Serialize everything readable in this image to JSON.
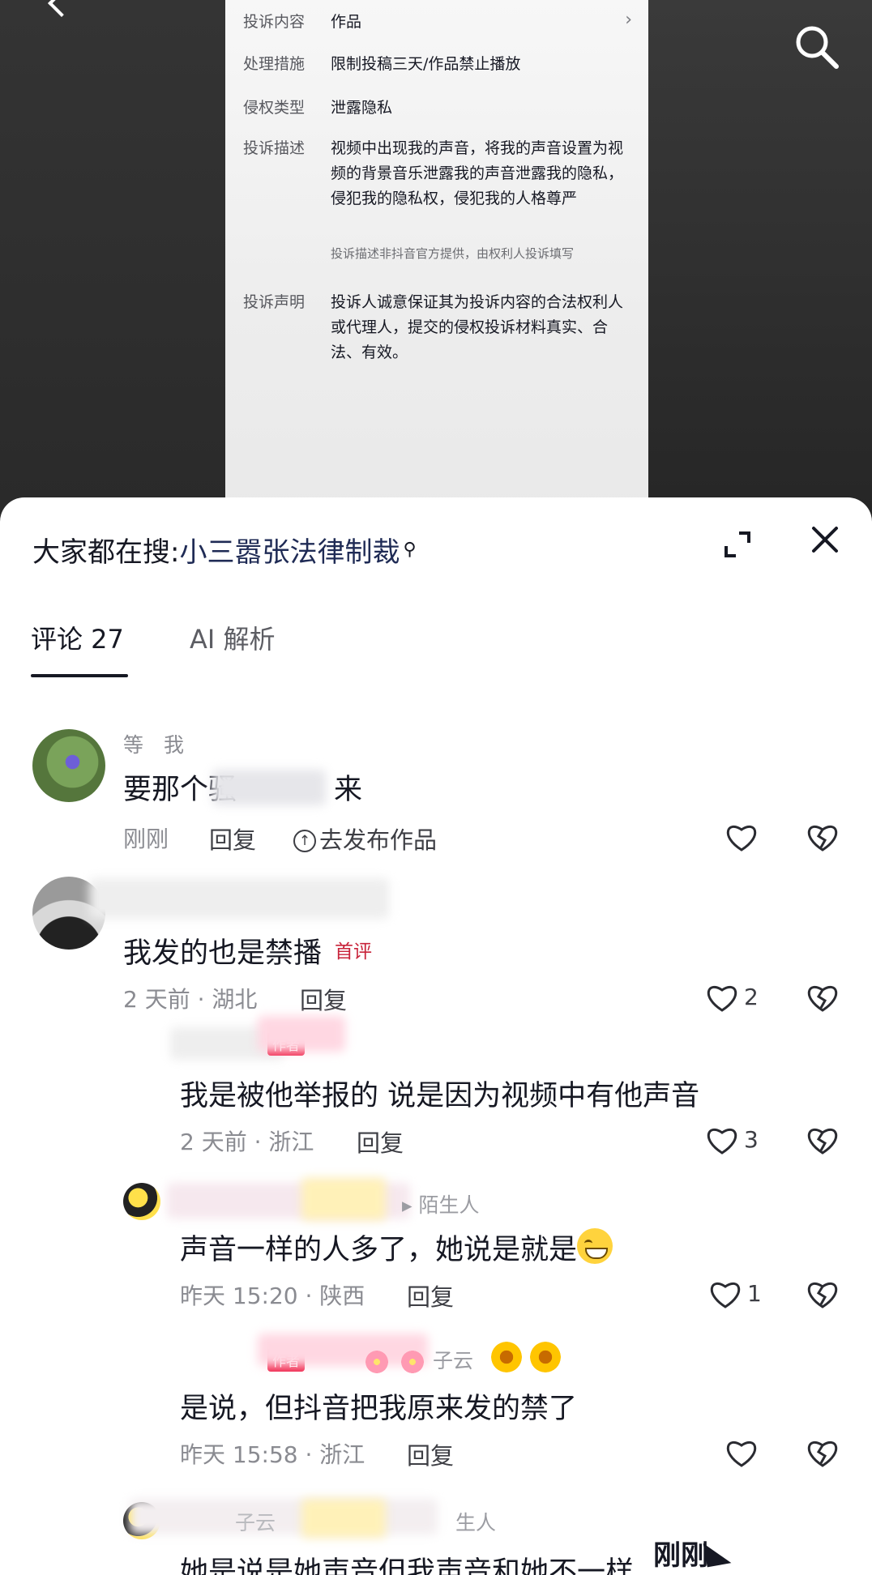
{
  "report": {
    "rows": [
      {
        "label": "投诉内容",
        "value": "作品"
      },
      {
        "label": "处理措施",
        "value": "限制投稿三天/作品禁止播放"
      },
      {
        "label": "侵权类型",
        "value": "泄露隐私"
      },
      {
        "label": "投诉描述",
        "value": "视频中出现我的声音，将我的声音设置为视频的背景音乐泄露我的声音泄露我的隐私，侵犯我的隐私权，侵犯我的人格尊严"
      },
      {
        "label": "投诉声明",
        "value": "投诉人诚意保证其为投诉内容的合法权利人或代理人，提交的侵权投诉材料真实、合法、有效。"
      }
    ],
    "note": "投诉描述非抖音官方提供，由权利人投诉填写",
    "chevron": "›"
  },
  "sheet": {
    "hot_search_prefix": "大家都在搜:",
    "hot_search_keyword": "小三嚣张法律制裁",
    "tabs": {
      "comments": "评论 27",
      "ai": "AI 解析"
    }
  },
  "comments": [
    {
      "username": "等　我",
      "text": "要那个骚",
      "text_tail": "来",
      "time": "刚刚",
      "reply": "回复",
      "publish": "去发布作品"
    },
    {
      "text": "我发的也是禁播",
      "tag": "首评",
      "time": "2 天前 · 湖北",
      "reply": "回复",
      "likes": "2"
    },
    {
      "badge": "作者",
      "text": "我是被他举报的 说是因为视频中有他声音",
      "time": "2 天前 · 浙江",
      "reply": "回复",
      "likes": "3"
    },
    {
      "username_tail": "陌生人",
      "text": "声音一样的人多了，她说是就是",
      "time": "昨天 15:20 · 陕西",
      "reply": "回复",
      "likes": "1"
    },
    {
      "badge": "作者",
      "username_tail": "子云",
      "text": "是说，但抖音把我原来发的禁了",
      "time": "昨天 15:58 · 浙江",
      "reply": "回复"
    },
    {
      "username_tail": "子云",
      "username_tail2": "生人",
      "text": "她是说是她声音但我声音和她不一样"
    }
  ],
  "overlay": {
    "just_now": "刚刚"
  },
  "icons": {
    "top_search": "search-icon",
    "expand": "expand-icon",
    "close": "close-icon",
    "like": "heart-icon",
    "dislike": "broken-heart-icon"
  },
  "colors": {
    "accent_tag": "#c8233a",
    "keyword": "#1f2b55"
  }
}
